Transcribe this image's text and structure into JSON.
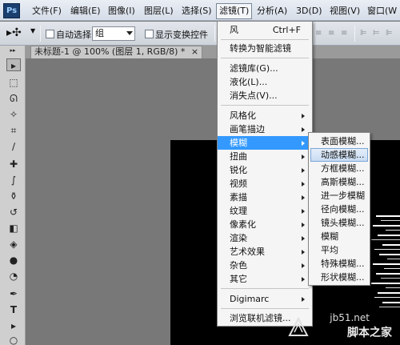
{
  "app": {
    "logo": "Ps"
  },
  "menubar": {
    "items": [
      {
        "label": "文件(F)"
      },
      {
        "label": "编辑(E)"
      },
      {
        "label": "图像(I)"
      },
      {
        "label": "图层(L)"
      },
      {
        "label": "选择(S)"
      },
      {
        "label": "滤镜(T)",
        "active": true
      },
      {
        "label": "分析(A)"
      },
      {
        "label": "3D(D)"
      },
      {
        "label": "视图(V)"
      },
      {
        "label": "窗口(W"
      }
    ]
  },
  "options": {
    "auto_select_label": "自动选择:",
    "auto_select_value": "组",
    "show_transform_label": "显示变换控件"
  },
  "document": {
    "tab_title": "未标题-1 @ 100% (图层 1, RGB/8) *"
  },
  "filter_menu": {
    "items": [
      {
        "label": "风",
        "shortcut": "Ctrl+F"
      },
      {
        "label": "转换为智能滤镜"
      },
      {
        "label": "滤镜库(G)..."
      },
      {
        "label": "液化(L)..."
      },
      {
        "label": "消失点(V)..."
      },
      {
        "label": "风格化",
        "submenu": true
      },
      {
        "label": "画笔描边",
        "submenu": true
      },
      {
        "label": "模糊",
        "submenu": true,
        "highlighted": true
      },
      {
        "label": "扭曲",
        "submenu": true
      },
      {
        "label": "锐化",
        "submenu": true
      },
      {
        "label": "视频",
        "submenu": true
      },
      {
        "label": "素描",
        "submenu": true
      },
      {
        "label": "纹理",
        "submenu": true
      },
      {
        "label": "像素化",
        "submenu": true
      },
      {
        "label": "渲染",
        "submenu": true
      },
      {
        "label": "艺术效果",
        "submenu": true
      },
      {
        "label": "杂色",
        "submenu": true
      },
      {
        "label": "其它",
        "submenu": true
      },
      {
        "label": "Digimarc",
        "submenu": true
      },
      {
        "label": "浏览联机滤镜..."
      }
    ]
  },
  "blur_submenu": {
    "items": [
      {
        "label": "表面模糊..."
      },
      {
        "label": "动感模糊...",
        "highlighted": true
      },
      {
        "label": "方框模糊..."
      },
      {
        "label": "高斯模糊..."
      },
      {
        "label": "进一步模糊"
      },
      {
        "label": "径向模糊..."
      },
      {
        "label": "镜头模糊..."
      },
      {
        "label": "模糊"
      },
      {
        "label": "平均"
      },
      {
        "label": "特殊模糊..."
      },
      {
        "label": "形状模糊..."
      }
    ]
  },
  "watermark": {
    "url": "jb51.net",
    "brand": "脚本之家"
  }
}
